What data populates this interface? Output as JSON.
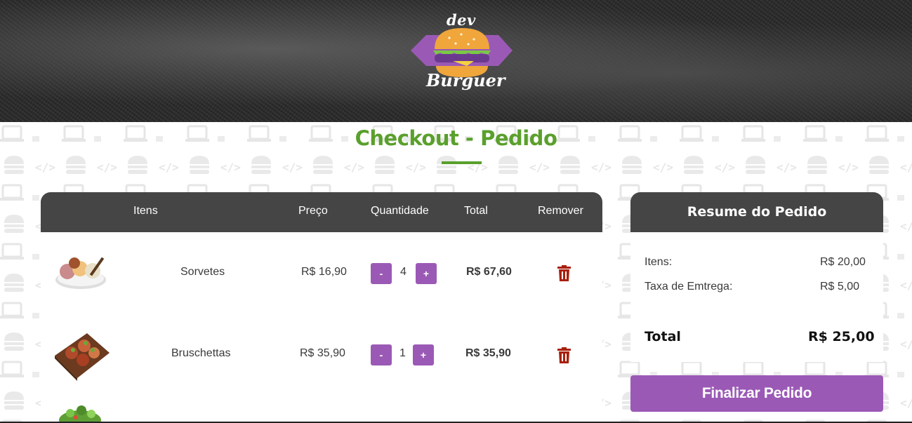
{
  "brand": {
    "top_word": "dev",
    "bottom_word": "Burguer"
  },
  "page_title": "Checkout - Pedido",
  "cart": {
    "headers": {
      "items": "Itens",
      "price": "Preço",
      "quantity": "Quantidade",
      "total": "Total",
      "remove": "Remover"
    },
    "rows": [
      {
        "name": "Sorvetes",
        "price": "R$ 16,90",
        "minus": "-",
        "qty": "4",
        "plus": "+",
        "total": "R$ 67,60",
        "image": "ice-cream-image",
        "remove_icon": "trash-icon"
      },
      {
        "name": "Bruschettas",
        "price": "R$ 35,90",
        "minus": "-",
        "qty": "1",
        "plus": "+",
        "total": "R$ 35,90",
        "image": "bruschetta-image",
        "remove_icon": "trash-icon"
      },
      {
        "name": "",
        "image": "salad-image"
      }
    ]
  },
  "summary": {
    "title": "Resume do Pedido",
    "items_label": "Itens:",
    "items_value": "R$ 20,00",
    "delivery_label": "Taxa de Emtrega:",
    "delivery_value": "R$ 5,00",
    "total_label": "Total",
    "total_value": "R$ 25,00"
  },
  "finish_button": "Finalizar Pedido",
  "colors": {
    "accent_green": "#5aa02c",
    "accent_purple": "#9b59b6",
    "header_gray": "#454545",
    "trash_red": "#a8200d"
  }
}
